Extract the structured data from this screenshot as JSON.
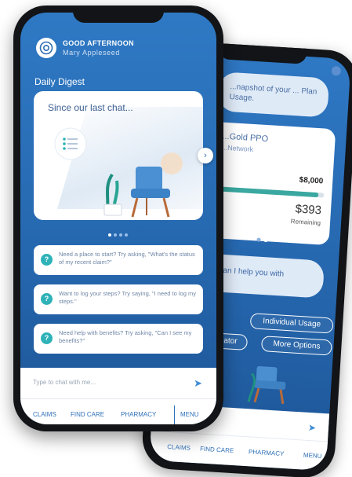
{
  "back_phone": {
    "snapshot_text": "...napshot of your ... Plan Usage.",
    "plan": {
      "name": "...Gold PPO",
      "network": "...Network",
      "max_amount": "$8,000",
      "remaining_amount": "$393",
      "remaining_label": "Remaining",
      "usage_fraction": 0.95
    },
    "help_text": "...can I help you with",
    "buttons": {
      "individual_usage": "Individual Usage",
      "estimator": "...mator",
      "more_options": "More Options"
    },
    "nav": [
      "CLAIMS",
      "FIND CARE",
      "PHARMACY",
      "MENU"
    ]
  },
  "front_phone": {
    "greeting": "GOOD AFTERNOON",
    "user_name": "Mary Appleseed",
    "digest_title": "Daily Digest",
    "digest_card_text": "Since our last chat...",
    "prompts": [
      "Need a place to start? Try asking, \"What's the status of my recent claim?\"",
      "Want to log your steps? Try saying, \"I need to log my steps.\"",
      "Need help with benefits? Try asking, \"Can I see my benefits?\""
    ],
    "chat_placeholder": "Type to chat with me...",
    "nav": {
      "claims": "CLAIMS",
      "find_care": "FIND CARE",
      "pharmacy": "PHARMACY",
      "menu": "MENU"
    }
  },
  "colors": {
    "screen_blue": "#2567ae",
    "accent_teal": "#2eb2b8",
    "nav_blue": "#2f70b8"
  },
  "icons": [
    "logo-icon",
    "chevron-right-icon",
    "question-icon",
    "send-icon",
    "info-icon",
    "chair-illustration"
  ]
}
